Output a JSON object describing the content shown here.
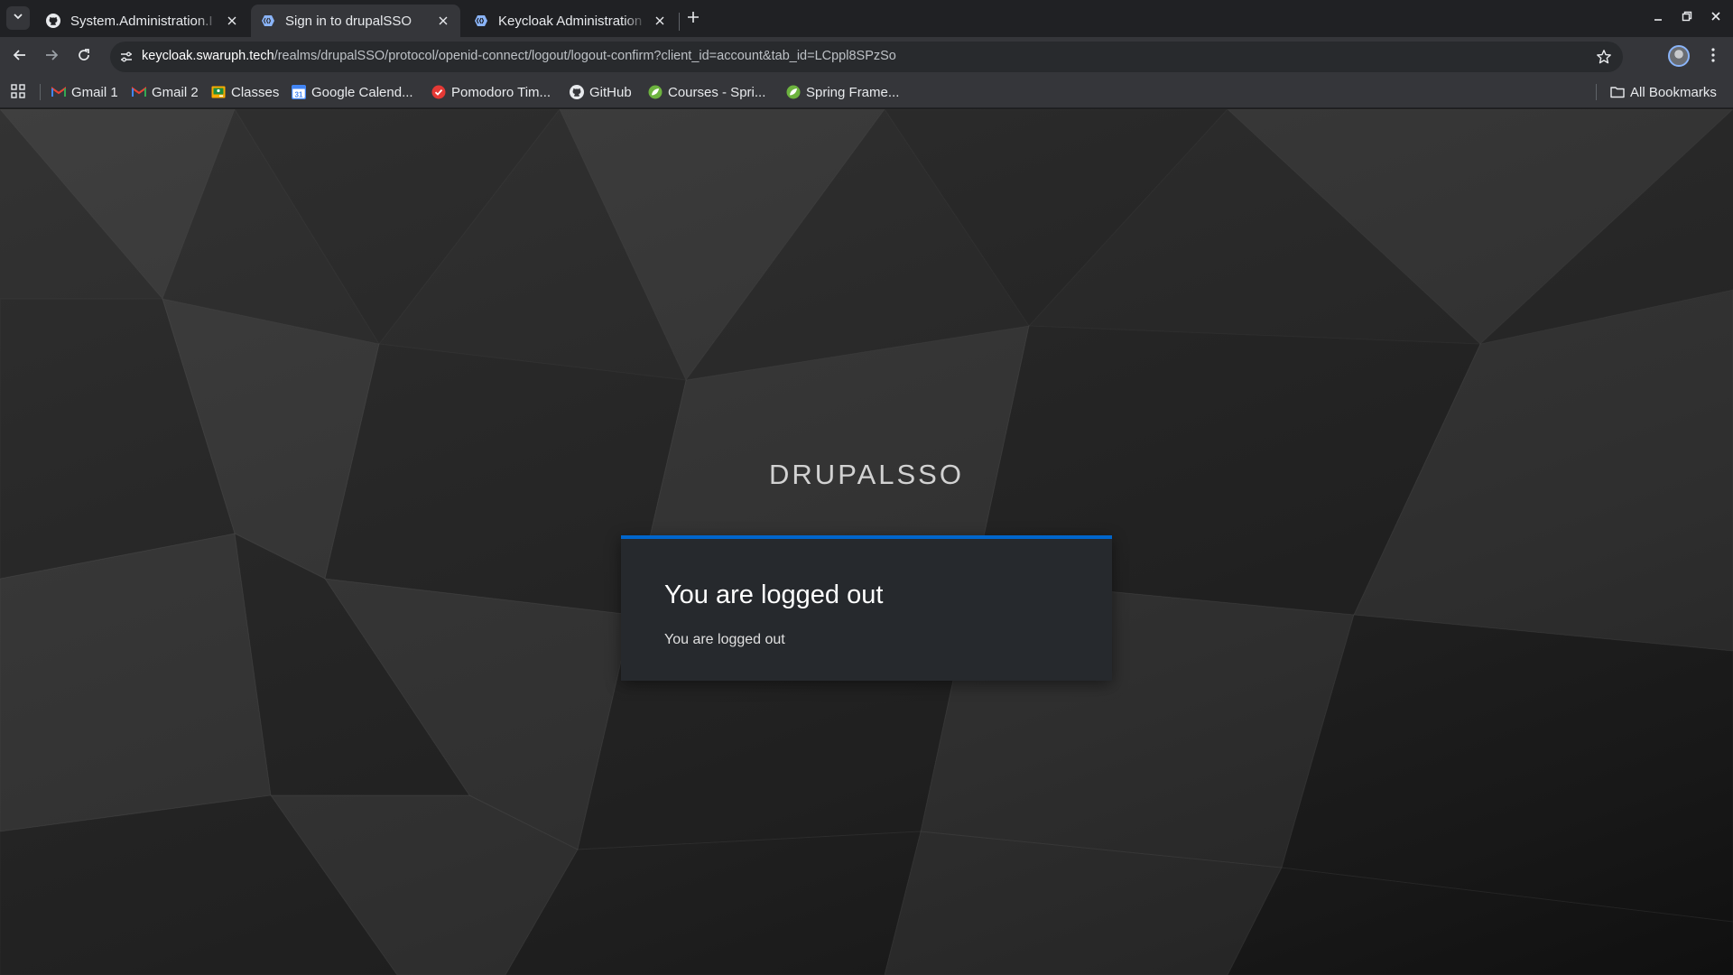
{
  "browser": {
    "tabs": [
      {
        "title": "System.Administration.I",
        "icon": "github-icon",
        "active": false
      },
      {
        "title": "Sign in to drupalSSO",
        "icon": "keycloak-icon",
        "active": true
      },
      {
        "title": "Keycloak Administration",
        "icon": "keycloak-icon",
        "active": false
      }
    ],
    "address": {
      "host": "keycloak.swaruph.tech",
      "path": "/realms/drupalSSO/protocol/openid-connect/logout/logout-confirm?client_id=account&tab_id=LCppl8SPzSo"
    },
    "bookmarks": [
      {
        "label": "Gmail 1",
        "icon": "gmail-icon"
      },
      {
        "label": "Gmail 2",
        "icon": "gmail-icon"
      },
      {
        "label": "Classes",
        "icon": "classroom-icon"
      },
      {
        "label": "Google Calend...",
        "icon": "calendar-icon"
      },
      {
        "label": "Pomodoro Tim...",
        "icon": "pomodoro-icon"
      },
      {
        "label": "GitHub",
        "icon": "github-icon"
      },
      {
        "label": "Courses - Spri...",
        "icon": "spring-icon"
      },
      {
        "label": "Spring Frame...",
        "icon": "spring-icon"
      }
    ],
    "all_bookmarks_label": "All Bookmarks",
    "colors": {
      "frame": "#202124",
      "toolbar": "#35363a",
      "omnibox": "#282a2d"
    }
  },
  "page": {
    "realm_title": "DRUPALSSO",
    "card": {
      "heading": "You are logged out",
      "message": "You are logged out",
      "accent_color": "#0066cc"
    }
  }
}
